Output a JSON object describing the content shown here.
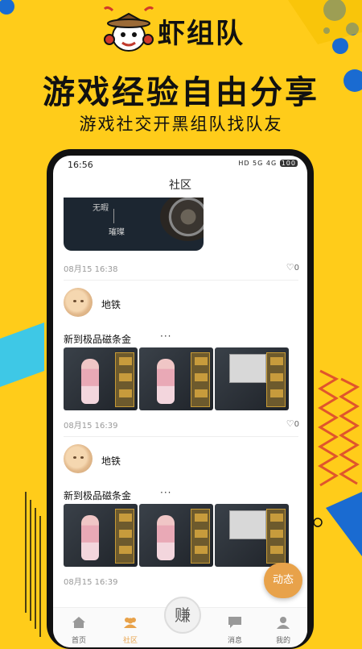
{
  "promo": {
    "brand": "虾组队",
    "headline": "游戏经验自由分享",
    "subline": "游戏社交开黑组队找队友"
  },
  "status_bar": {
    "time": "16:56",
    "icons": "HD 5G 4G",
    "battery": "100"
  },
  "page_title": "社区",
  "posts": [
    {
      "image_text_1": "无暇",
      "image_text_2": "璀璨",
      "time": "08月15 16:38",
      "likes": "0"
    },
    {
      "user": "地铁",
      "text": "新到极品磁条金",
      "more": "···",
      "time": "08月15 16:39",
      "likes": "0"
    },
    {
      "user": "地铁",
      "text": "新到极品磁条金",
      "more": "···",
      "time": "08月15 16:39"
    }
  ],
  "fab_label": "动态",
  "tabs": [
    {
      "label": "首页",
      "icon": "home-icon"
    },
    {
      "label": "社区",
      "icon": "community-icon"
    },
    {
      "label": "赚",
      "icon": "earn-icon"
    },
    {
      "label": "消息",
      "icon": "message-icon"
    },
    {
      "label": "我的",
      "icon": "profile-icon"
    }
  ],
  "colors": {
    "background": "#FFCC1A",
    "accent": "#E8A24A"
  }
}
